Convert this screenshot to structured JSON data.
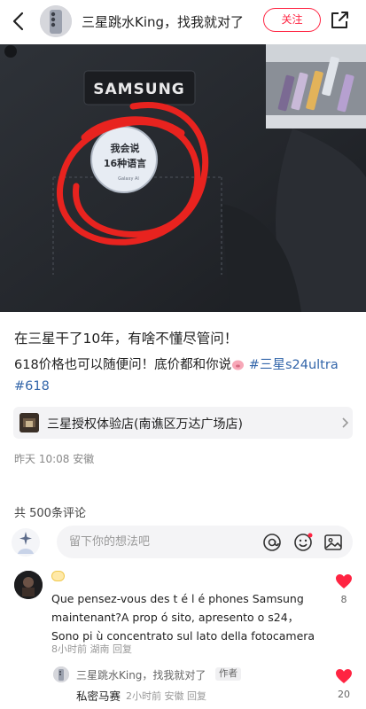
{
  "header": {
    "author_name": "三星跳水King，找我就对了",
    "follow_label": "关注",
    "icons": [
      "back-arrow-icon",
      "share-icon"
    ]
  },
  "photo": {
    "brand_patch": "SAMSUNG",
    "badge_line1": "我会说",
    "badge_line2": "16种语言",
    "badge_small": "Galaxy AI",
    "annotation_color": "#e8231f"
  },
  "post": {
    "title": "在三星干了10年，有啥不懂尽管问！",
    "body_text": "618价格也可以随便问！底价都和你说",
    "tag1": "#三星s24ultra",
    "tag2": "#618"
  },
  "location": {
    "name": "三星授权体验店(南谯区万达广场店)"
  },
  "meta": {
    "time": "昨天 10:08",
    "region": "安徽"
  },
  "comments": {
    "count_label": "共 500条评论",
    "input_placeholder": "留下你的想法吧",
    "items": [
      {
        "text": "Que pensez-vous des t é l é phones Samsung maintenant?A prop ó sito, apresento o s24， Sono pi ù  concentrato sul lato della fotocamera",
        "time": "8小时前",
        "region": "湖南",
        "reply": "回复",
        "likes": "8"
      },
      {
        "name": "三星跳水King，找我就对了",
        "author_tag": "作者",
        "text": "私密马赛",
        "time": "2小时前",
        "region": "安徽",
        "reply": "回复",
        "likes": "20"
      }
    ]
  },
  "colors": {
    "accent": "#ff2442",
    "tag": "#3366aa",
    "heart": "#ff2442"
  }
}
